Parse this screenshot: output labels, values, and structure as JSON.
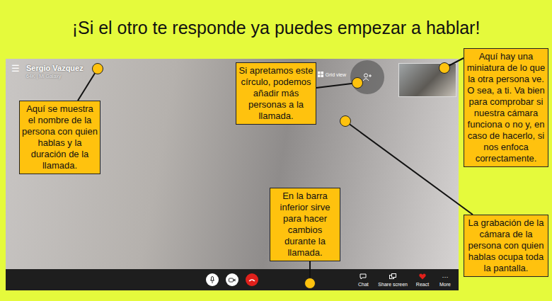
{
  "title": "¡Si el otro te responde ya puedes empezar a hablar!",
  "call": {
    "menu_icon": "☰",
    "contact_name": "Sergio Vazquez",
    "call_info": "64K | Mi Galaxy",
    "grid_view": "Grid view"
  },
  "bottom_bar": {
    "actions": [
      {
        "label": "Chat"
      },
      {
        "label": "Share screen"
      },
      {
        "label": "React"
      },
      {
        "label": "More",
        "icon": "···"
      }
    ]
  },
  "annotations": [
    {
      "text": "Aquí se muestra el nombre de la persona con quien hablas y la duración de la llamada."
    },
    {
      "text": "Si apretamos este círculo, podemos añadir más personas a la llamada."
    },
    {
      "text": "Aquí hay una miniatura de lo que la otra persona ve. O sea, a ti. Va bien para comprobar si nuestra cámara funciona o no y, en caso de hacerlo, si nos enfoca correctamente."
    },
    {
      "text": "La grabación de la cámara de la persona con quien hablas ocupa toda la pantalla."
    },
    {
      "text": "En la barra inferior sirve para hacer cambios durante la llamada."
    }
  ]
}
